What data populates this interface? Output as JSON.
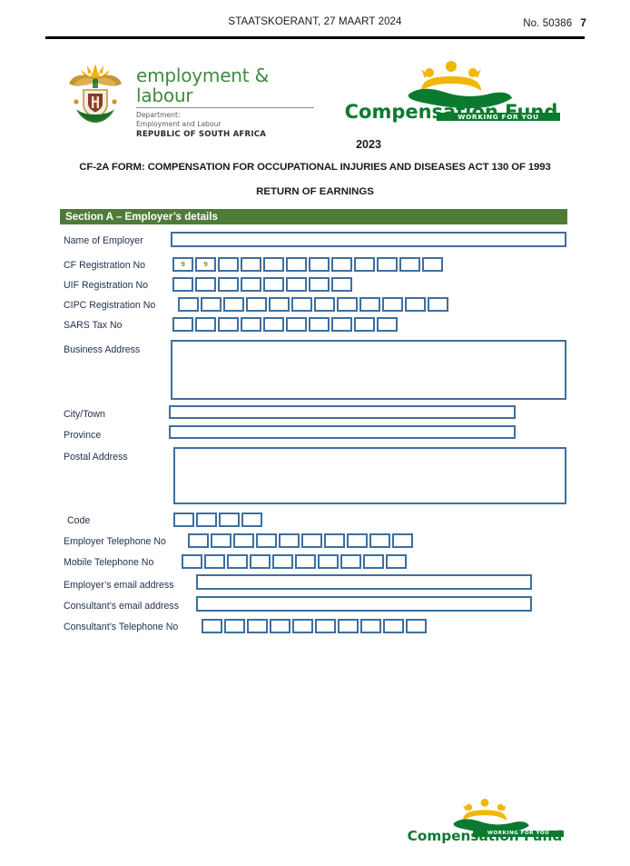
{
  "running_head": {
    "gazette": "STAATSKOERANT, 27 MAART 2024",
    "issue_label": "No. 50386",
    "page_number": "7"
  },
  "department_logo": {
    "icon": "south-african-coat-of-arms",
    "title": "employment & labour",
    "line1": "Department:",
    "line2": "Employment and Labour",
    "line3": "REPUBLIC OF SOUTH AFRICA"
  },
  "compensation_fund_logo": {
    "icon": "compensation-fund-hand-and-people",
    "name": "Compensation Fund",
    "tagline": "WORKING FOR YOU"
  },
  "document": {
    "year": "2023",
    "title": "CF-2A FORM: COMPENSATION FOR OCCUPATIONAL INJURIES AND DISEASES ACT 130 OF 1993",
    "subtitle": "RETURN OF EARNINGS"
  },
  "section_a": {
    "heading": "Section A – Employer’s details",
    "rows": [
      {
        "label": "Name of Employer",
        "type": "line"
      },
      {
        "label": "CF Registration No",
        "type": "cells",
        "count": 12,
        "values": [
          "9",
          "9",
          "",
          "",
          "",
          "",
          "",
          "",
          "",
          "",
          "",
          ""
        ]
      },
      {
        "label": "UIF Registration No",
        "type": "cells",
        "count": 8,
        "values": [
          "",
          "",
          "",
          "",
          "",
          "",
          "",
          ""
        ]
      },
      {
        "label": "CIPC Registration No",
        "type": "cells",
        "count": 12,
        "values": [
          "",
          "",
          "",
          "",
          "",
          "",
          "",
          "",
          "",
          "",
          "",
          ""
        ]
      },
      {
        "label": "SARS Tax No",
        "type": "cells",
        "count": 10,
        "values": [
          "",
          "",
          "",
          "",
          "",
          "",
          "",
          "",
          "",
          ""
        ]
      },
      {
        "label": "Business Address",
        "type": "textarea"
      },
      {
        "label": "City/Town",
        "type": "line"
      },
      {
        "label": "Province",
        "type": "line"
      },
      {
        "label": "Postal Address",
        "type": "textarea"
      },
      {
        "label": "Code",
        "type": "cells",
        "count": 4,
        "values": [
          "",
          "",
          "",
          ""
        ]
      },
      {
        "label": "Employer Telephone No",
        "type": "cells",
        "count": 10,
        "values": [
          "",
          "",
          "",
          "",
          "",
          "",
          "",
          "",
          "",
          ""
        ]
      },
      {
        "label": "Mobile Telephone No",
        "type": "cells",
        "count": 10,
        "values": [
          "",
          "",
          "",
          "",
          "",
          "",
          "",
          "",
          "",
          ""
        ]
      },
      {
        "label": "Employer’s email address",
        "type": "line"
      },
      {
        "label": "Consultant’s email address",
        "type": "line"
      },
      {
        "label": "Consultant’s Telephone No",
        "type": "cells",
        "count": 10,
        "values": [
          "",
          "",
          "",
          "",
          "",
          "",
          "",
          "",
          "",
          ""
        ]
      }
    ]
  },
  "colors": {
    "section_green": "#4F7B38",
    "field_border": "#3E6F9E",
    "logo_green": "#0b7a2f",
    "logo_yellow": "#F2B705",
    "prefill_text": "#9a9326"
  }
}
